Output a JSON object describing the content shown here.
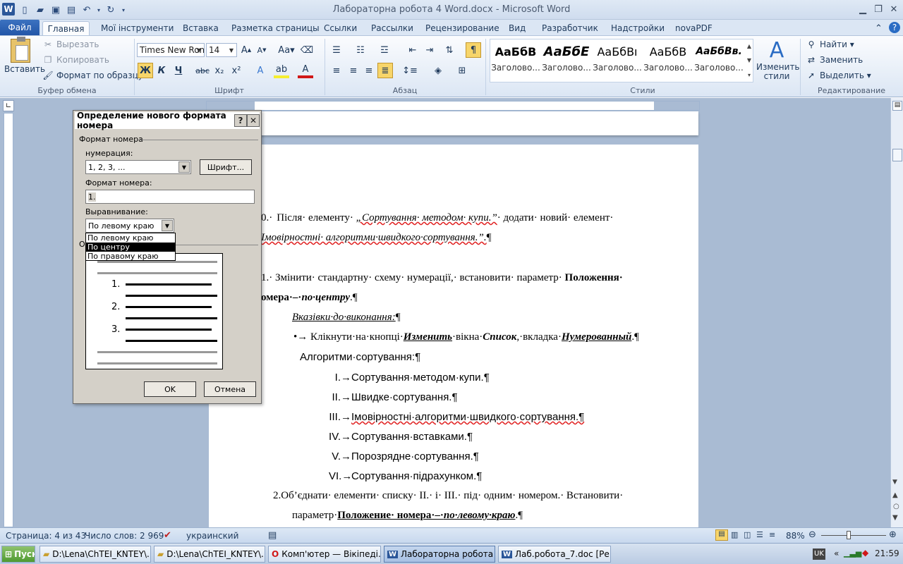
{
  "app": {
    "title": "Лабораторна робота 4 Word.docx  -  Microsoft Word",
    "logo": "W"
  },
  "tabs": [
    "Файл",
    "Главная",
    "Мої інструменти",
    "Вставка",
    "Разметка страницы",
    "Ссылки",
    "Рассылки",
    "Рецензирование",
    "Вид",
    "Разработчик",
    "Надстройки",
    "novaPDF"
  ],
  "ribbon": {
    "clipboard": {
      "paste": "Вставить",
      "cut": "Вырезать",
      "copy": "Копировать",
      "format_painter": "Формат по образцу",
      "label": "Буфер обмена"
    },
    "font": {
      "name": "Times New Rom",
      "size": "14",
      "bold": "Ж",
      "italic": "К",
      "underline": "Ч",
      "strike": "abc",
      "sub": "x₂",
      "sup": "x²",
      "label": "Шрифт"
    },
    "paragraph": {
      "label": "Абзац"
    },
    "styles": {
      "items": [
        {
          "sample": "АаБбВ",
          "name": "Заголово..."
        },
        {
          "sample": "АаБбЕ",
          "name": "Заголово..."
        },
        {
          "sample": "АаБбВı",
          "name": "Заголово..."
        },
        {
          "sample": "АаБбВ",
          "name": "Заголово..."
        },
        {
          "sample": "АаБбВв.",
          "name": "Заголово..."
        }
      ],
      "change": "Изменить стили",
      "label": "Стили"
    },
    "editing": {
      "find": "Найти",
      "replace": "Заменить",
      "select": "Выделить",
      "label": "Редактирование"
    }
  },
  "dialog": {
    "title": "Определение нового формата номера",
    "help": "?",
    "close": "✕",
    "section": "Формат номера",
    "numbering_label": "нумерация:",
    "numbering_value": "1, 2, 3, ...",
    "font_button": "Шрифт...",
    "format_label": "Формат номера:",
    "format_value": "1.",
    "alignment_label": "Выравнивание:",
    "alignment_value": "По левому краю",
    "options": [
      "По левому краю",
      "По центру",
      "По правому краю"
    ],
    "preview_partial": "О",
    "preview_nums": [
      "1.",
      "2.",
      "3."
    ],
    "ok": "OK",
    "cancel": "Отмена"
  },
  "document": {
    "p10a_num": "0.·",
    "p10a_text1": "Після· елементу· ",
    "p10a_italic": "„Сортування· методом· купи.”",
    "p10a_text2": "· додати· новий· елемент·",
    "p10b_italic": "Імовірностні· алгоритми·швидкого·сортування.”.",
    "p10b_mark": "¶",
    "p11a_num": "1.·",
    "p11a_text": "Змінити· стандартну· схему· нумерації,· встановити· параметр·",
    "p11a_bold": "Положення·",
    "p11b_bold": "омера·–·",
    "p11b_bolditalic": "по·центру",
    "p11b_end": ".¶",
    "hint": "Вказівки·до·виконання:",
    "hint_mark": "¶",
    "bullet_text1": "•→ Клікнути·на·кнопці·",
    "bullet_bi1": "Изменить",
    "bullet_text2": "·вікна·",
    "bullet_bi2": "Список",
    "bullet_text3": ",·вкладка·",
    "bullet_bi3": "Нумерованный",
    "bullet_end": ".¶",
    "list_title": "Алгоритми·сортування:¶",
    "list_items": [
      {
        "num": "I.→",
        "text": "Сортування·методом·купи.¶"
      },
      {
        "num": "II.→",
        "text": "Швидке·сортування.¶"
      },
      {
        "num": "III.→",
        "text": "Імовірностні·алгоритми·швидкого·сортування.¶"
      },
      {
        "num": "IV.→",
        "text": "Сортування·вставками.¶"
      },
      {
        "num": "V.→",
        "text": "Порозрядне·сортування.¶"
      },
      {
        "num": "VI.→",
        "text": "Сортування·підрахунком.¶"
      }
    ],
    "p2a_num": "2.",
    "p2a_text": "Об’єднати· елементи· списку· II.· і· III.· під· одним· номером.· Встановити·",
    "p2b_text": "параметр·",
    "p2b_bold": "Положение· номера·–·",
    "p2b_bolditalic": "по·левому·краю",
    "p2b_end": ".¶"
  },
  "status": {
    "page": "Страница: 4 из 43",
    "words": "Число слов: 2 969",
    "lang": "украинский",
    "zoom": "88%"
  },
  "taskbar": {
    "start": "Пуск",
    "items": [
      {
        "label": "D:\\Lena\\ChTEI_KNTEY\\..."
      },
      {
        "label": "D:\\Lena\\ChTEI_KNTEY\\..."
      },
      {
        "label": "Комп'ютер — Вікіпеді..."
      },
      {
        "label": "Лабораторна робота ..."
      },
      {
        "label": "Лаб.робота_7.doc [Ре..."
      }
    ],
    "lang": "UK",
    "clock": "21:59"
  }
}
